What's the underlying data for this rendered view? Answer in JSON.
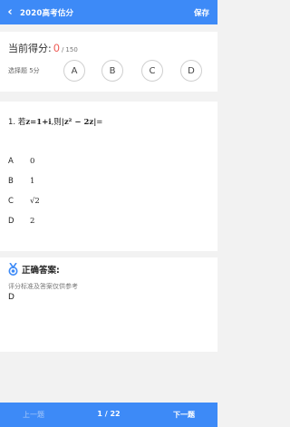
{
  "header": {
    "back_glyph": "‹",
    "title": "2020高考估分",
    "save_label": "保存"
  },
  "score": {
    "label": "当前得分:",
    "current": "0",
    "separator": "/",
    "total": "150",
    "select_label": "选择题 5分",
    "options": [
      "A",
      "B",
      "C",
      "D"
    ]
  },
  "question": {
    "number": "1.",
    "stem_prefix": "若",
    "stem_math1": "z=1+i",
    "stem_middle": ",则",
    "stem_math2": "|z² − 2z|",
    "stem_suffix": "=",
    "choices": [
      {
        "letter": "A",
        "value": "0"
      },
      {
        "letter": "B",
        "value": "1"
      },
      {
        "letter": "C",
        "value": "√2"
      },
      {
        "letter": "D",
        "value": "2"
      }
    ]
  },
  "answer": {
    "title": "正确答案:",
    "note": "评分标准及答案仅供参考",
    "value": "D"
  },
  "footer": {
    "prev_label": "上一题",
    "current_page": "1",
    "page_sep": "/",
    "total_pages": "22",
    "next_label": "下一题"
  },
  "colors": {
    "primary": "#3d8af7",
    "score_highlight": "#ee5b55",
    "background": "#f2f2f2"
  },
  "icons": {
    "back": "chevron-left-icon",
    "answer": "medal-icon"
  }
}
